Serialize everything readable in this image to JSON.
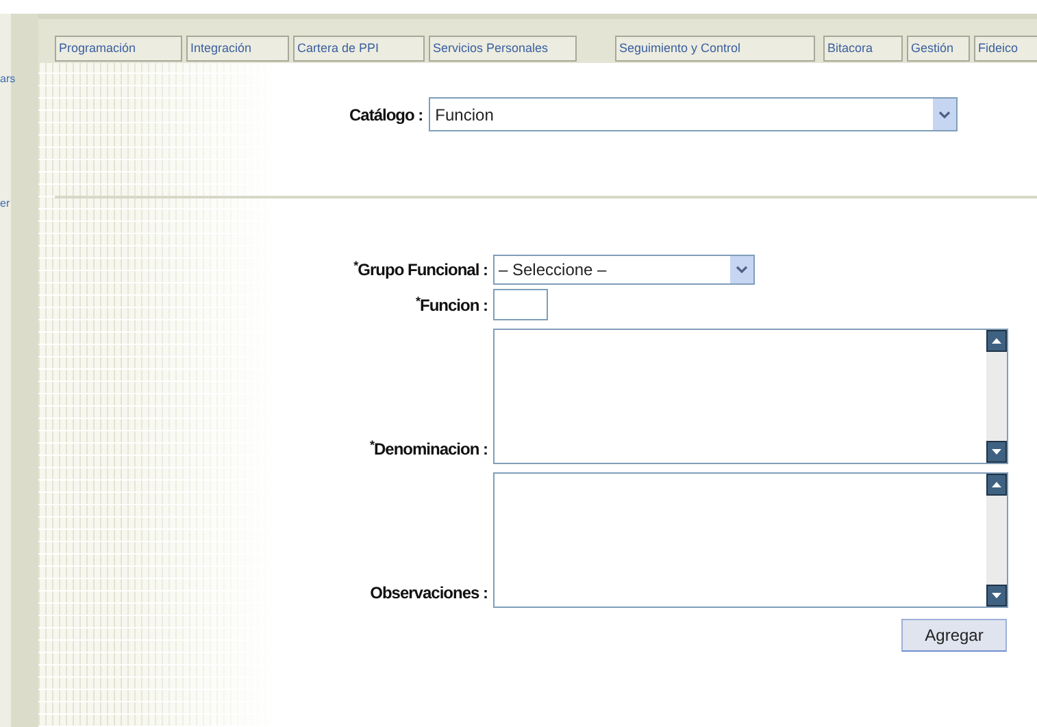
{
  "tabs": [
    {
      "label": "Programación"
    },
    {
      "label": "Integración"
    },
    {
      "label": "Cartera de PPI"
    },
    {
      "label": "Servicios Personales"
    },
    {
      "label": "Seguimiento y Control"
    },
    {
      "label": "Bitacora"
    },
    {
      "label": "Gestión"
    },
    {
      "label": "Fideico"
    }
  ],
  "side_fragments": [
    "ars",
    "er"
  ],
  "catalog": {
    "label": "Catálogo :",
    "value": "Funcion"
  },
  "fields": [
    {
      "kind": "select",
      "label": "$^{*}$Grupo Funcional :",
      "value": "– Seleccione –"
    },
    {
      "kind": "input",
      "label": "$^{*}$Funcion :"
    },
    {
      "kind": "textarea",
      "label": "$^{*}$Denominacion :"
    },
    {
      "kind": "textarea",
      "label": "Observaciones :"
    }
  ],
  "button": "Agregar"
}
